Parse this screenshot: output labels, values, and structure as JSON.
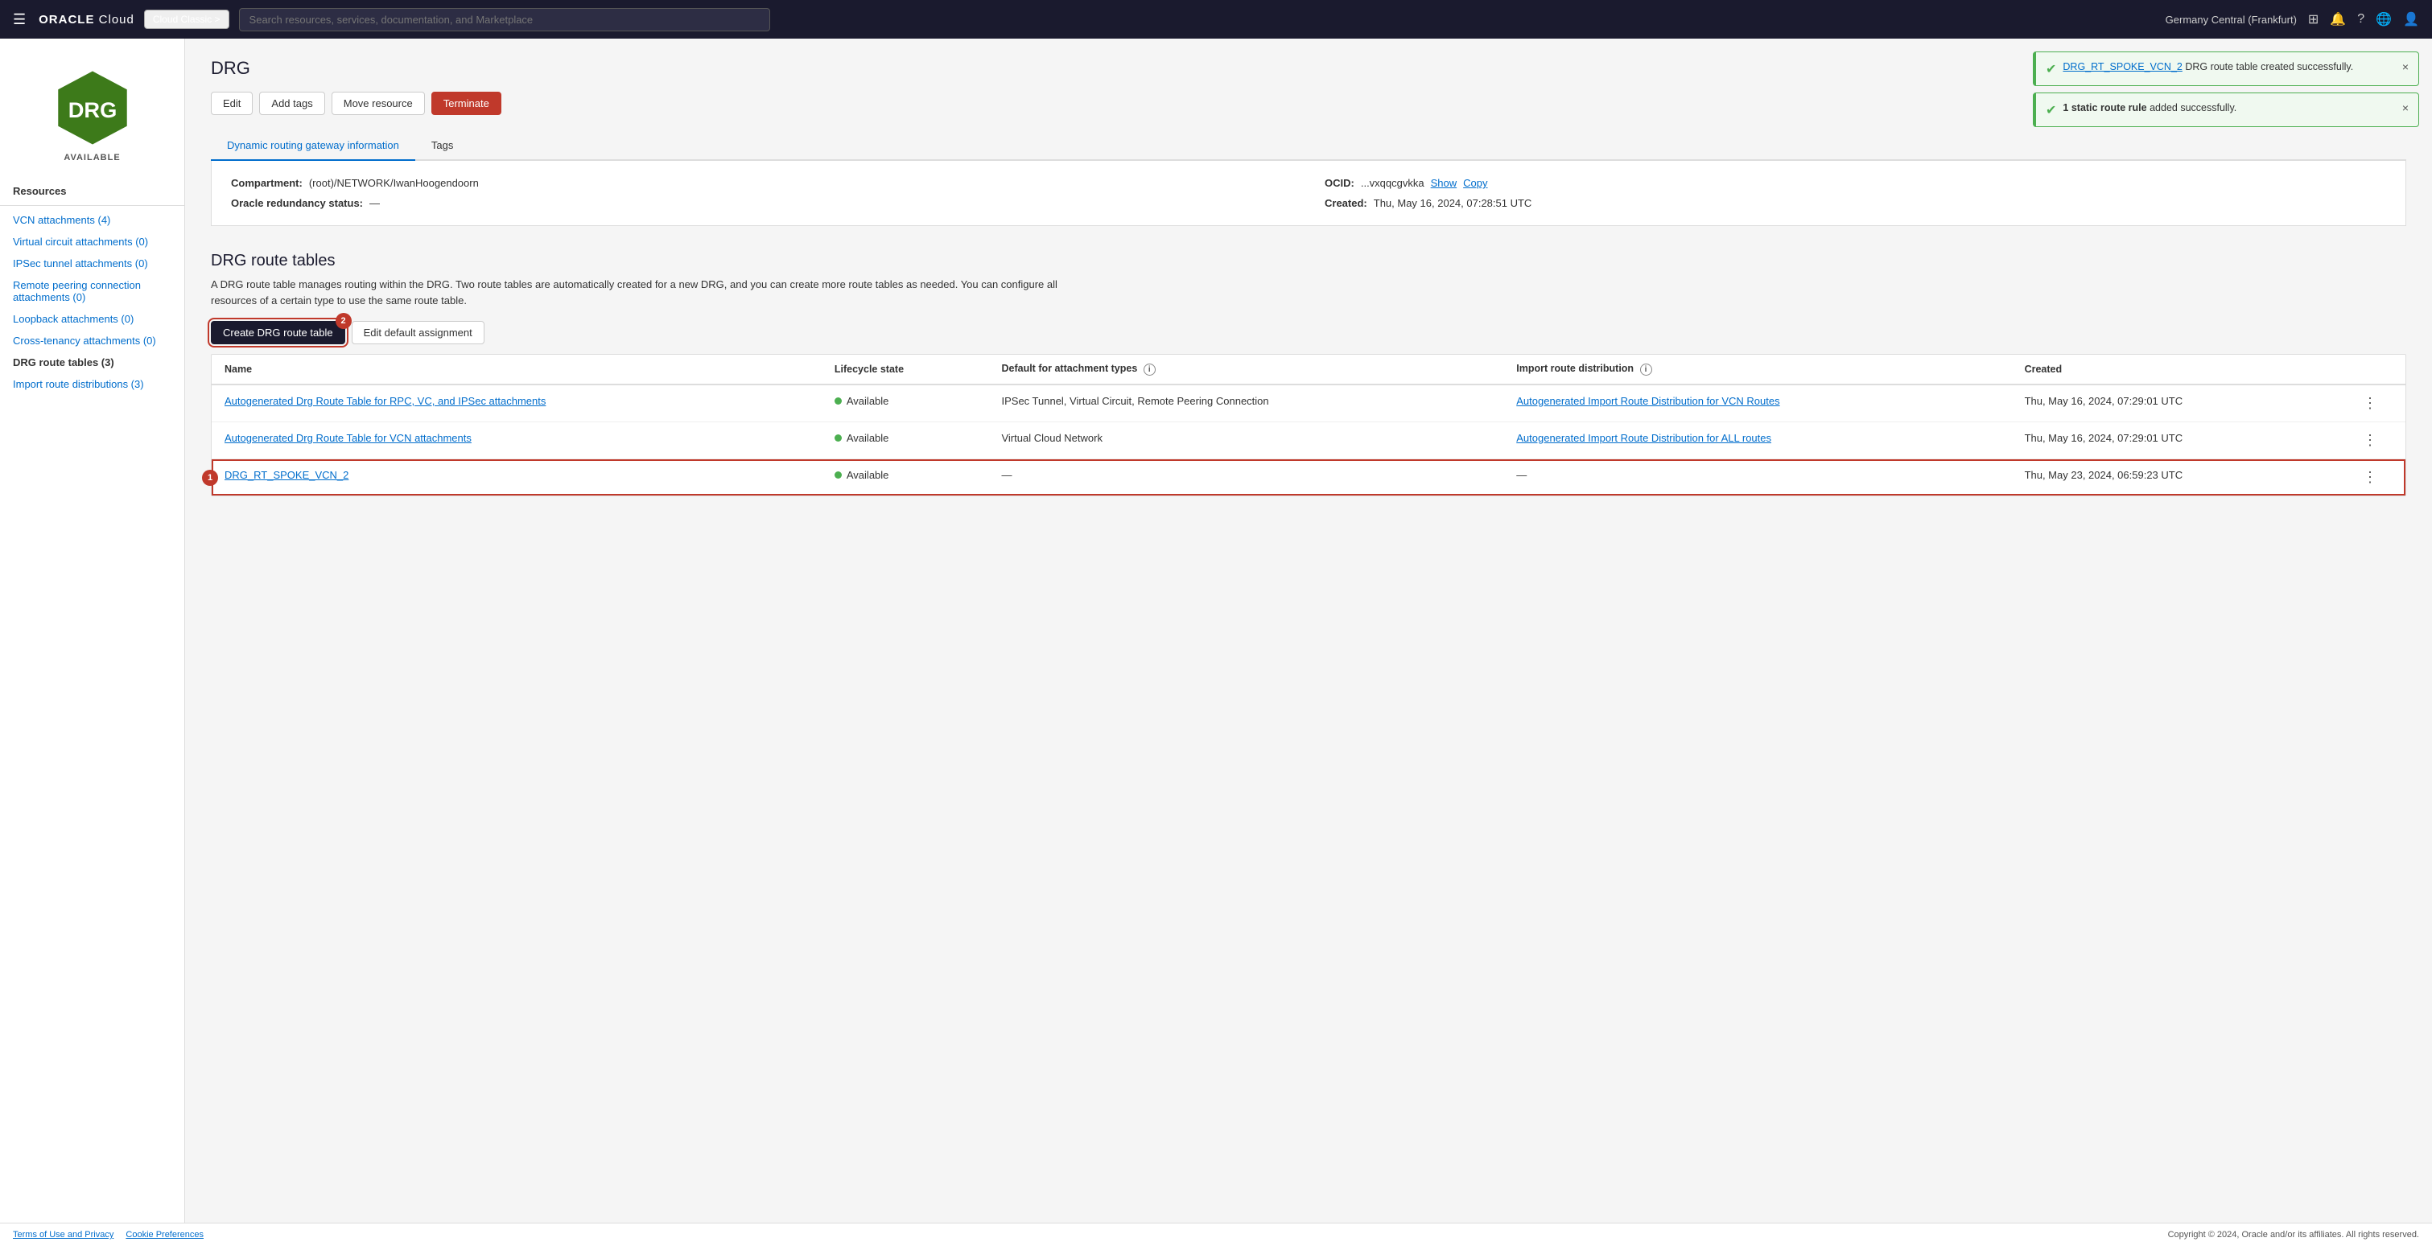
{
  "nav": {
    "hamburger": "☰",
    "logo_oracle": "ORACLE",
    "logo_cloud": " Cloud",
    "cloud_classic_btn": "Cloud Classic >",
    "search_placeholder": "Search resources, services, documentation, and Marketplace",
    "region": "Germany Central (Frankfurt)",
    "region_chevron": "▾"
  },
  "sidebar": {
    "drg_label": "DRG",
    "status": "AVAILABLE",
    "resources_title": "Resources",
    "links": [
      {
        "label": "VCN attachments (4)",
        "active": false
      },
      {
        "label": "Virtual circuit attachments (0)",
        "active": false
      },
      {
        "label": "IPSec tunnel attachments (0)",
        "active": false
      },
      {
        "label": "Remote peering connection attachments (0)",
        "active": false
      },
      {
        "label": "Loopback attachments (0)",
        "active": false
      },
      {
        "label": "Cross-tenancy attachments (0)",
        "active": false
      },
      {
        "label": "DRG route tables (3)",
        "active": true
      },
      {
        "label": "Import route distributions (3)",
        "active": false
      }
    ]
  },
  "page": {
    "title": "DRG",
    "edit_btn": "Edit",
    "add_tags_btn": "Add tags",
    "move_resource_btn": "Move resource",
    "terminate_btn": "Terminate"
  },
  "tabs": [
    {
      "label": "Dynamic routing gateway information",
      "active": true
    },
    {
      "label": "Tags",
      "active": false
    }
  ],
  "info": {
    "compartment_label": "Compartment",
    "compartment_value": "(root)/NETWORK/IwanHoogendoorn",
    "ocid_label": "OCID:",
    "ocid_value": "...vxqqcgvkka",
    "show_link": "Show",
    "copy_link": "Copy",
    "redundancy_label": "Oracle redundancy status:",
    "redundancy_value": "—",
    "created_label": "Created:",
    "created_value": "Thu, May 16, 2024, 07:28:51 UTC"
  },
  "route_tables": {
    "title": "DRG route tables",
    "description": "A DRG route table manages routing within the DRG. Two route tables are automatically created for a new DRG, and you can create more route tables as needed. You can configure all resources of a certain type to use the same route table.",
    "create_btn": "Create DRG route table",
    "edit_default_btn": "Edit default assignment",
    "columns": [
      {
        "label": "Name"
      },
      {
        "label": "Lifecycle state"
      },
      {
        "label": "Default for attachment types"
      },
      {
        "label": "Import route distribution"
      },
      {
        "label": "Created"
      }
    ],
    "rows": [
      {
        "name": "Autogenerated Drg Route Table for RPC, VC, and IPSec attachments",
        "lifecycle": "Available",
        "default_types": "IPSec Tunnel, Virtual Circuit, Remote Peering Connection",
        "import_dist": "Autogenerated Import Route Distribution for VCN Routes",
        "created": "Thu, May 16, 2024, 07:29:01 UTC",
        "highlighted": false,
        "badge": null
      },
      {
        "name": "Autogenerated Drg Route Table for VCN attachments",
        "lifecycle": "Available",
        "default_types": "Virtual Cloud Network",
        "import_dist": "Autogenerated Import Route Distribution for ALL routes",
        "created": "Thu, May 16, 2024, 07:29:01 UTC",
        "highlighted": false,
        "badge": null
      },
      {
        "name": "DRG_RT_SPOKE_VCN_2",
        "lifecycle": "Available",
        "default_types": "—",
        "import_dist": "—",
        "created": "Thu, May 23, 2024, 06:59:23 UTC",
        "highlighted": true,
        "badge": "1"
      }
    ]
  },
  "notifications": [
    {
      "link_text": "DRG_RT_SPOKE_VCN_2",
      "text": " DRG route table created successfully.",
      "close": "×"
    },
    {
      "link_text": null,
      "text": "1 static route rule added successfully.",
      "bold_text": "1 static route rule",
      "close": "×"
    }
  ],
  "footer": {
    "left_links": [
      "Terms of Use and Privacy",
      "Cookie Preferences"
    ],
    "right_text": "Copyright © 2024, Oracle and/or its affiliates. All rights reserved."
  }
}
